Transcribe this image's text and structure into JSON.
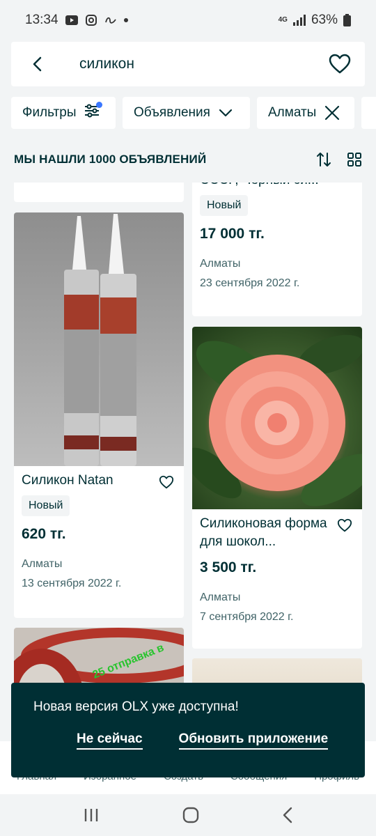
{
  "status_bar": {
    "time": "13:34",
    "network": "4G",
    "battery": "63%"
  },
  "search": {
    "query": "силикон"
  },
  "chips": {
    "filters": "Фильтры",
    "category": "Объявления",
    "city": "Алматы"
  },
  "results": {
    "title": "МЫ НАШЛИ 1000 ОБЪЯВЛЕНИЙ"
  },
  "listings": [
    {
      "title": "СССР, Черный си...",
      "condition": "Новый",
      "price": "17 000 тг.",
      "location": "Алматы",
      "date": "23 сентября 2022 г."
    },
    {
      "title": "Силикон Natan",
      "condition": "Новый",
      "price": "620 тг.",
      "location": "Алматы",
      "date": "13 сентября 2022 г."
    },
    {
      "title": "Силиконовая форма для шокол...",
      "condition": "",
      "price": "3 500 тг.",
      "location": "Алматы",
      "date": "7 сентября 2022 г."
    },
    {
      "photo_text": "25 отправка в"
    }
  ],
  "snackbar": {
    "message": "Новая версия OLX уже доступна!",
    "dismiss": "Не сейчас",
    "update": "Обновить приложение"
  },
  "bottom_nav": {
    "home": "Главная",
    "favorites": "Избранное",
    "create": "Создать",
    "messages": "Сообщения",
    "profile": "Профиль"
  },
  "colors": {
    "primary": "#002f34",
    "background": "#f2f4f5",
    "card": "#ffffff",
    "muted": "#406367"
  }
}
